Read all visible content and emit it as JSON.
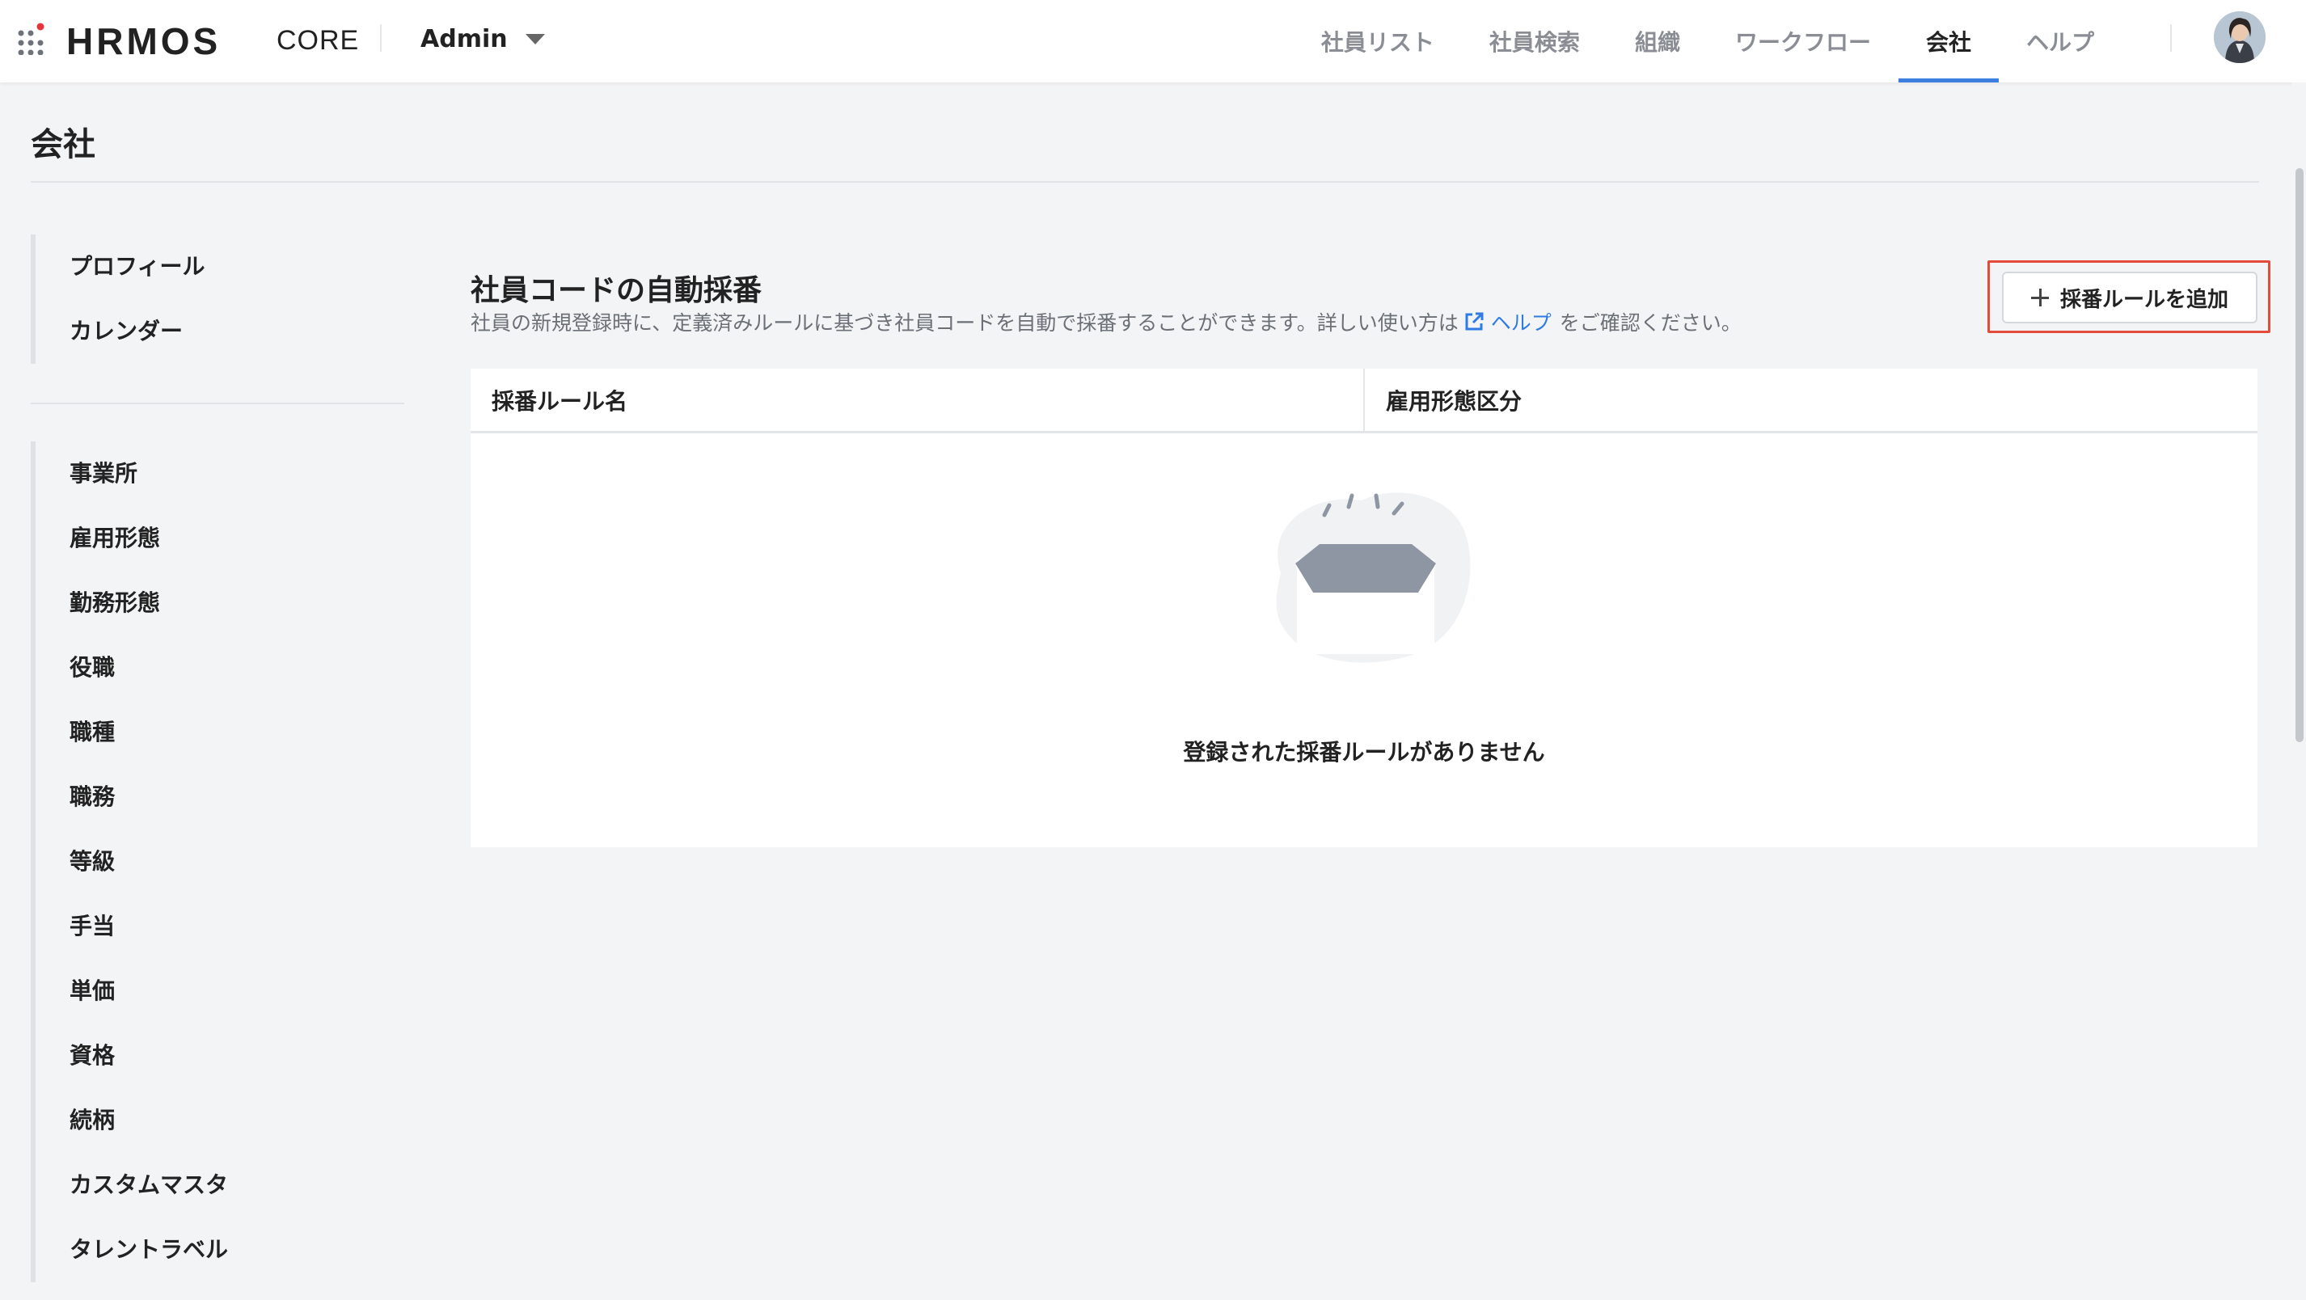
{
  "app": {
    "brand": "HRMOS",
    "product": "CORE",
    "workspace": "Admin"
  },
  "nav": {
    "items": [
      {
        "label": "社員リスト",
        "active": false
      },
      {
        "label": "社員検索",
        "active": false
      },
      {
        "label": "組織",
        "active": false
      },
      {
        "label": "ワークフロー",
        "active": false
      },
      {
        "label": "会社",
        "active": true
      },
      {
        "label": "ヘルプ",
        "active": false
      }
    ]
  },
  "page": {
    "title": "会社"
  },
  "sidebar": {
    "group1": [
      {
        "label": "プロフィール"
      },
      {
        "label": "カレンダー"
      }
    ],
    "group2": [
      {
        "label": "事業所"
      },
      {
        "label": "雇用形態"
      },
      {
        "label": "勤務形態"
      },
      {
        "label": "役職"
      },
      {
        "label": "職種"
      },
      {
        "label": "職務"
      },
      {
        "label": "等級"
      },
      {
        "label": "手当"
      },
      {
        "label": "単価"
      },
      {
        "label": "資格"
      },
      {
        "label": "続柄"
      },
      {
        "label": "カスタムマスタ"
      },
      {
        "label": "タレントラベル"
      }
    ]
  },
  "section": {
    "title": "社員コードの自動採番",
    "desc_before": "社員の新規登録時に、定義済みルールに基づき社員コードを自動で採番することができます。詳しい使い方は",
    "help_link": "ヘルプ",
    "desc_after": "をご確認ください。",
    "add_button": "採番ルールを追加"
  },
  "table": {
    "columns": [
      "採番ルール名",
      "雇用形態区分"
    ],
    "empty_message": "登録された採番ルールがありません"
  },
  "colors": {
    "accent": "#3d7fe0",
    "link": "#2f7be5",
    "highlight": "#e34b3b",
    "brand_dot": "#e5343a"
  },
  "icons": {
    "apps": "apps-grid-icon",
    "caret": "caret-down-icon",
    "external": "external-link-icon",
    "plus": "plus-icon",
    "empty": "empty-box-icon"
  }
}
